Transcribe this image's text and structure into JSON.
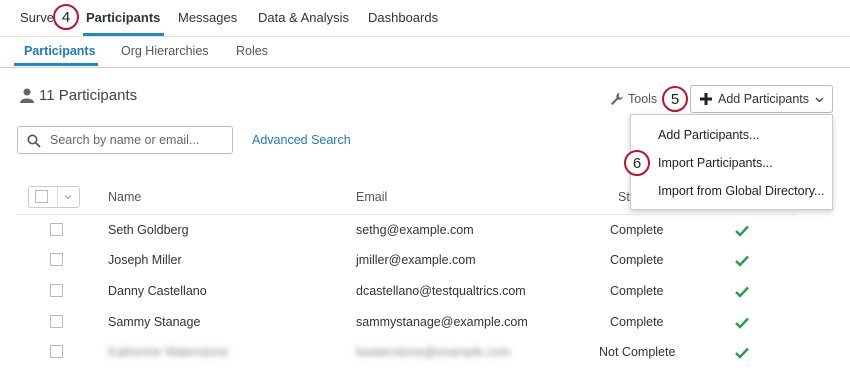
{
  "top_tabs": [
    "Survey",
    "Participants",
    "Messages",
    "Data & Analysis",
    "Dashboards"
  ],
  "sub_tabs": [
    "Participants",
    "Org Hierarchies",
    "Roles"
  ],
  "participant_count": "11 Participants",
  "search": {
    "placeholder": "Search by name or email..."
  },
  "advanced_search": "Advanced Search",
  "tools_label": "Tools",
  "add_button_label": "Add Participants",
  "menu": [
    "Add Participants...",
    "Import Participants...",
    "Import from Global Directory..."
  ],
  "callouts": [
    "4",
    "5",
    "6"
  ],
  "columns": {
    "name": "Name",
    "email": "Email",
    "status": "St"
  },
  "rows": [
    {
      "name": "Seth Goldberg",
      "email": "sethg@example.com",
      "status": "Complete"
    },
    {
      "name": "Joseph Miller",
      "email": "jmiller@example.com",
      "status": "Complete"
    },
    {
      "name": "Danny Castellano",
      "email": "dcastellano@testqualtrics.com",
      "status": "Complete"
    },
    {
      "name": "Sammy Stanage",
      "email": "sammystanage@example.com",
      "status": "Complete"
    },
    {
      "name": "Katherine Waterstone",
      "email": "kwaterstone@example.com",
      "status": "Not Complete"
    }
  ],
  "colors": {
    "accent": "#1e88c8",
    "link": "#1e7ab8",
    "callout_border": "#c0122e",
    "check": "#2a9d4a"
  }
}
